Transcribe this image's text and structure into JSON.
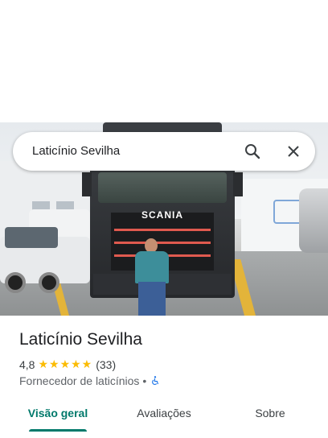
{
  "search": {
    "query": "Laticínio Sevilha"
  },
  "hero": {
    "truck_brand": "SCANIA"
  },
  "place": {
    "name": "Laticínio Sevilha",
    "rating": "4,8",
    "stars": "★★★★★",
    "review_count": "(33)",
    "category": "Fornecedor de laticínios",
    "separator": "•"
  },
  "tabs": [
    {
      "label": "Visão geral"
    },
    {
      "label": "Avaliações"
    },
    {
      "label": "Sobre"
    }
  ],
  "colors": {
    "accent": "#00796b",
    "star": "#fbbc04",
    "accessibility": "#1a73e8"
  }
}
